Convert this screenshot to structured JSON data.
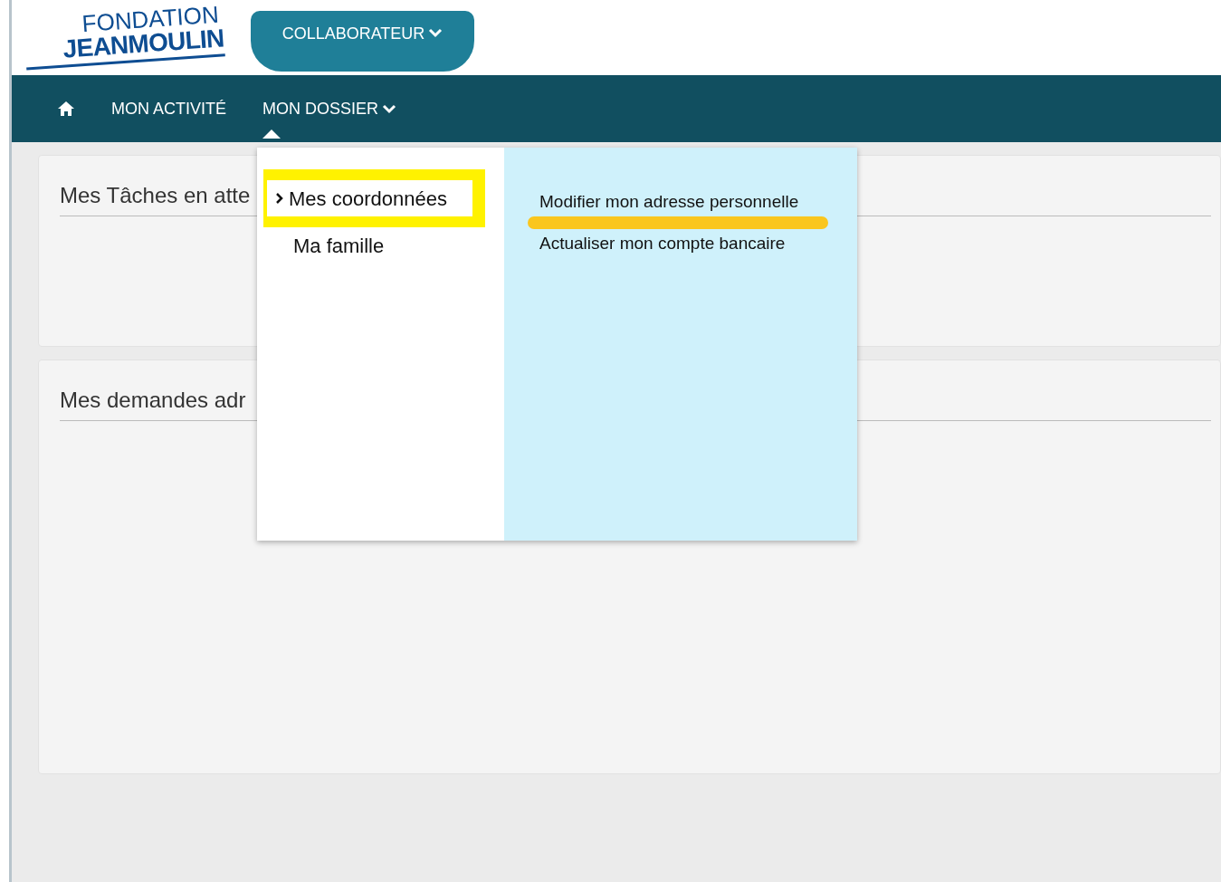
{
  "logo": {
    "line_1": "FONDATION",
    "line_2": "JEANMOULIN"
  },
  "role_button": {
    "label": "COLLABORATEUR"
  },
  "nav": {
    "items": [
      {
        "label": "MON ACTIVITÉ",
        "dropdown": false
      },
      {
        "label": "MON DOSSIER",
        "dropdown": true
      }
    ]
  },
  "dropdown_menu": {
    "sections": [
      {
        "label": "Mes coordonnées",
        "selected": true
      },
      {
        "label": "Ma famille",
        "selected": false
      }
    ],
    "links": [
      {
        "label": "Modifier mon adresse personnelle"
      },
      {
        "label": "Actualiser mon compte bancaire"
      }
    ]
  },
  "panels": [
    {
      "title": "Mes Tâches en atte"
    },
    {
      "title": "Mes demandes adr"
    }
  ]
}
